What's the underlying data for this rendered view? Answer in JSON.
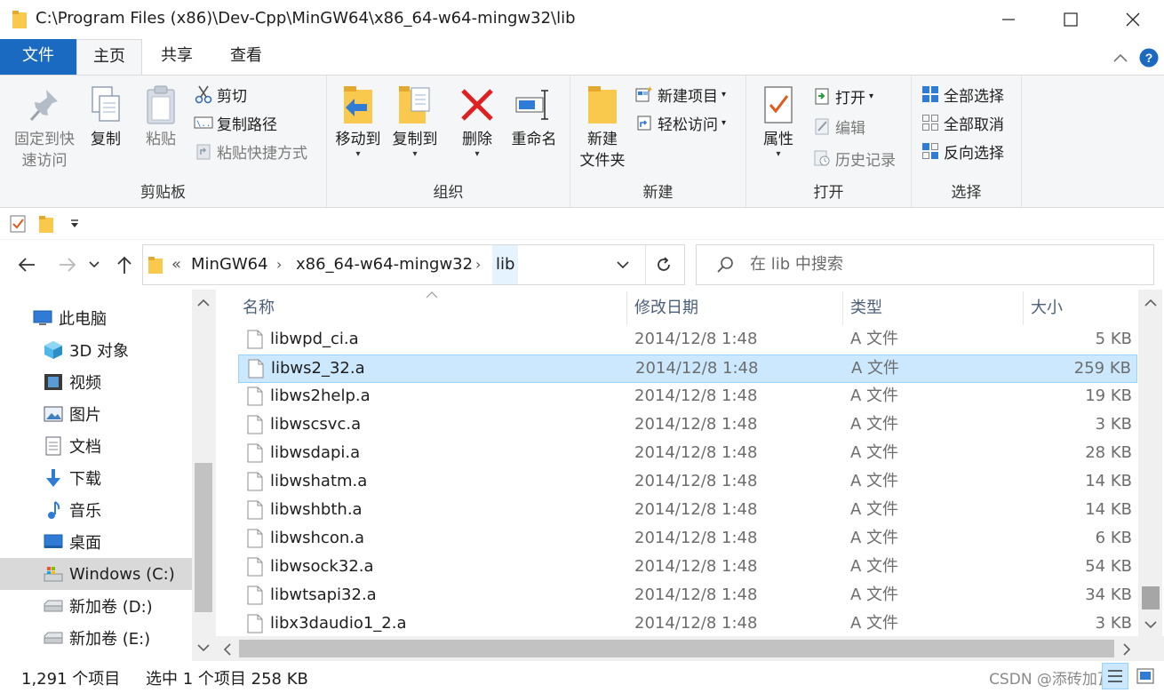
{
  "window": {
    "title": "C:\\Program Files (x86)\\Dev-Cpp\\MinGW64\\x86_64-w64-mingw32\\lib"
  },
  "tabs": {
    "file": "文件",
    "home": "主页",
    "share": "共享",
    "view": "查看"
  },
  "ribbon": {
    "clipboard": {
      "label": "剪贴板",
      "pin_line1": "固定到快",
      "pin_line2": "速访问",
      "copy": "复制",
      "paste": "粘贴",
      "cut": "剪切",
      "copy_path": "复制路径",
      "paste_shortcut": "粘贴快捷方式"
    },
    "organize": {
      "label": "组织",
      "move_to": "移动到",
      "copy_to": "复制到",
      "delete": "删除",
      "rename": "重命名"
    },
    "new": {
      "label": "新建",
      "new_folder_line1": "新建",
      "new_folder_line2": "文件夹",
      "new_item": "新建项目",
      "easy_access": "轻松访问"
    },
    "open": {
      "label": "打开",
      "properties": "属性",
      "open": "打开",
      "edit": "编辑",
      "history": "历史记录"
    },
    "select": {
      "label": "选择",
      "select_all": "全部选择",
      "select_none": "全部取消",
      "invert": "反向选择"
    }
  },
  "address": {
    "overflow": "«",
    "crumbs": [
      "MinGW64",
      "x86_64-w64-mingw32",
      "lib"
    ],
    "search_placeholder": "在 lib 中搜索"
  },
  "nav": {
    "items": [
      {
        "label": "此电脑",
        "icon": "computer-icon"
      },
      {
        "label": "3D 对象",
        "icon": "3d-objects-icon"
      },
      {
        "label": "视频",
        "icon": "video-icon"
      },
      {
        "label": "图片",
        "icon": "pictures-icon"
      },
      {
        "label": "文档",
        "icon": "documents-icon"
      },
      {
        "label": "下载",
        "icon": "download-icon"
      },
      {
        "label": "音乐",
        "icon": "music-icon"
      },
      {
        "label": "桌面",
        "icon": "desktop-icon"
      },
      {
        "label": "Windows (C:)",
        "icon": "drive-c-icon"
      },
      {
        "label": "新加卷 (D:)",
        "icon": "drive-icon"
      },
      {
        "label": "新加卷 (E:)",
        "icon": "drive-icon"
      }
    ],
    "selected_index": 8
  },
  "columns": {
    "name": "名称",
    "date": "修改日期",
    "type": "类型",
    "size": "大小"
  },
  "files": [
    {
      "name": "libwpd_ci.a",
      "date": "2014/12/8 1:48",
      "type": "A 文件",
      "size": "5 KB"
    },
    {
      "name": "libws2_32.a",
      "date": "2014/12/8 1:48",
      "type": "A 文件",
      "size": "259 KB"
    },
    {
      "name": "libws2help.a",
      "date": "2014/12/8 1:48",
      "type": "A 文件",
      "size": "19 KB"
    },
    {
      "name": "libwscsvc.a",
      "date": "2014/12/8 1:48",
      "type": "A 文件",
      "size": "3 KB"
    },
    {
      "name": "libwsdapi.a",
      "date": "2014/12/8 1:48",
      "type": "A 文件",
      "size": "28 KB"
    },
    {
      "name": "libwshatm.a",
      "date": "2014/12/8 1:48",
      "type": "A 文件",
      "size": "14 KB"
    },
    {
      "name": "libwshbth.a",
      "date": "2014/12/8 1:48",
      "type": "A 文件",
      "size": "14 KB"
    },
    {
      "name": "libwshcon.a",
      "date": "2014/12/8 1:48",
      "type": "A 文件",
      "size": "6 KB"
    },
    {
      "name": "libwsock32.a",
      "date": "2014/12/8 1:48",
      "type": "A 文件",
      "size": "54 KB"
    },
    {
      "name": "libwtsapi32.a",
      "date": "2014/12/8 1:48",
      "type": "A 文件",
      "size": "34 KB"
    },
    {
      "name": "libx3daudio1_2.a",
      "date": "2014/12/8 1:48",
      "type": "A 文件",
      "size": "3 KB"
    }
  ],
  "selected_file_index": 1,
  "status": {
    "count": "1,291 个项目",
    "selection": "选中 1 个项目  258 KB",
    "watermark": "CSDN @添砖加瓦v"
  },
  "colors": {
    "accent": "#1b6ac2",
    "selection": "#cce8ff",
    "selection_border": "#99d1ff",
    "folder": "#f8c94c"
  }
}
